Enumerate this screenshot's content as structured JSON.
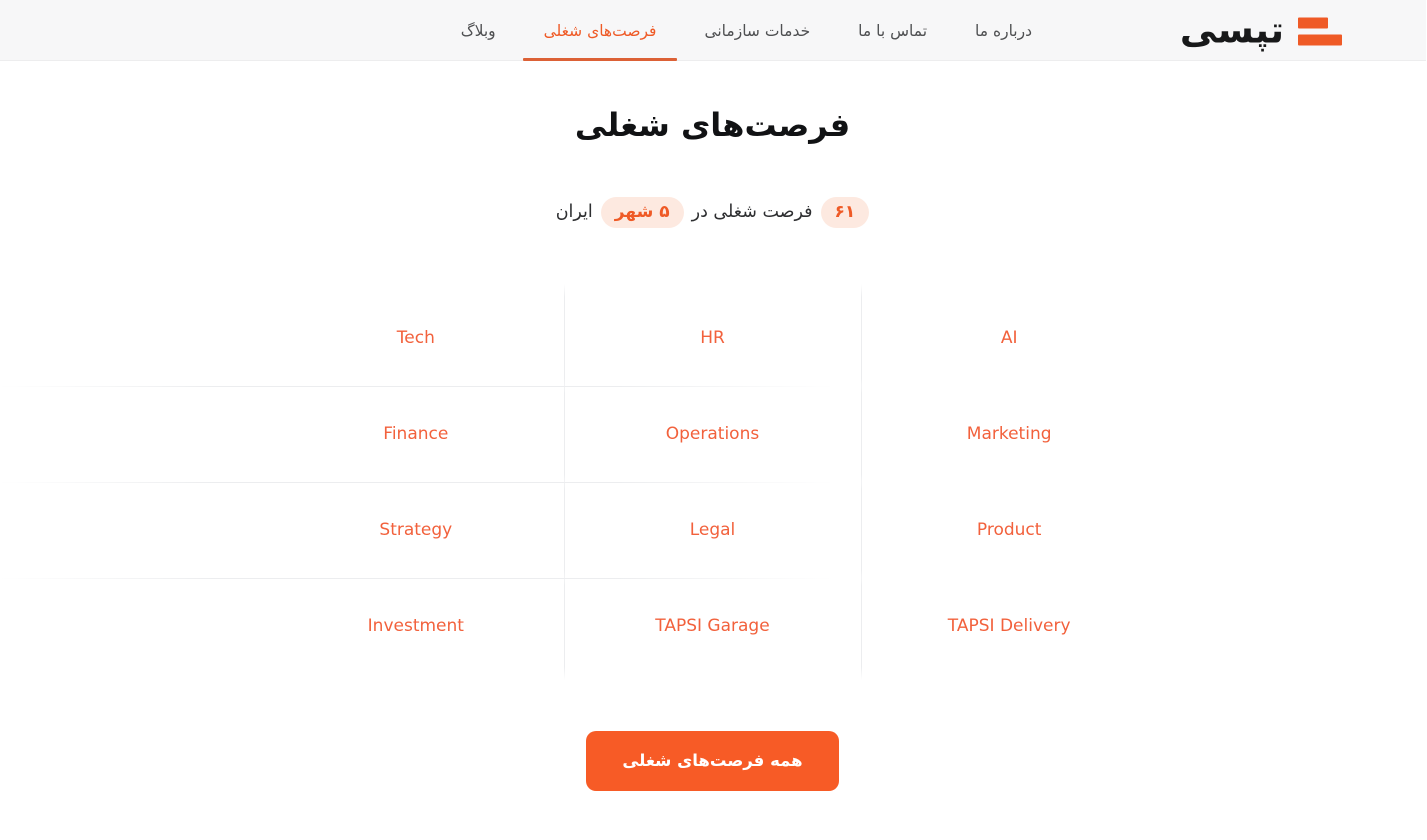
{
  "header": {
    "logo": {
      "word": "تپسی",
      "bars_icon": "tapsi-logo-bars-icon",
      "color": "#ef5a26"
    },
    "nav": [
      {
        "label": "درباره ما",
        "active": false
      },
      {
        "label": "تماس با ما",
        "active": false
      },
      {
        "label": "خدمات سازمانی",
        "active": false
      },
      {
        "label": "فرصت‌های شغلی",
        "active": true
      },
      {
        "label": "وبلاگ",
        "active": false
      }
    ]
  },
  "main": {
    "title": "فرصت‌های شغلی",
    "subtitle": {
      "count_badge": "۶۱",
      "middle_text": "فرصت شغلی در",
      "city_badge": "۵ شهر",
      "tail_text": "ایران"
    },
    "categories": [
      "Tech",
      "HR",
      "AI",
      "Finance",
      "Operations",
      "Marketing",
      "Strategy",
      "Legal",
      "Product",
      "Investment",
      "TAPSI Garage",
      "TAPSI Delivery"
    ],
    "cta_label": "همه فرصت‌های شغلی"
  },
  "colors": {
    "brand_orange": "#ef5a26",
    "cta_orange": "#f75b26",
    "category_text": "#f2613c",
    "badge_bg": "#fde9e0",
    "header_bg": "#f7f7f8",
    "divider": "#ecedef"
  }
}
